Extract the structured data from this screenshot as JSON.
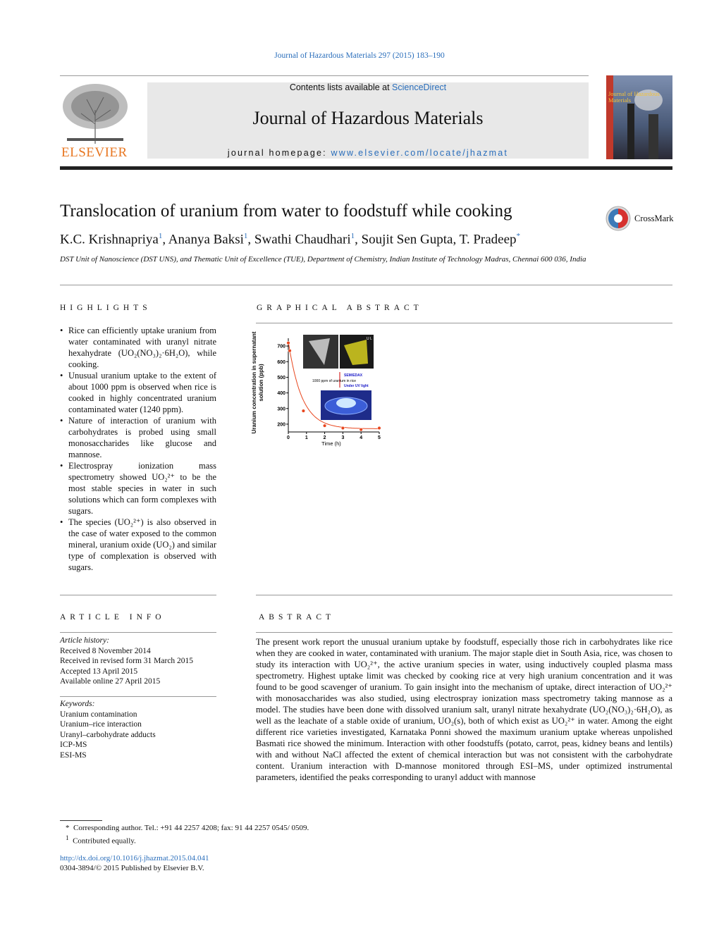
{
  "journal_ref": "Journal of Hazardous Materials 297 (2015) 183–190",
  "header": {
    "contents_prefix": "Contents lists available at ",
    "contents_link": "ScienceDirect",
    "journal_title": "Journal of Hazardous Materials",
    "homepage_prefix": "journal homepage: ",
    "homepage_link": "www.elsevier.com/locate/jhazmat",
    "publisher": "ELSEVIER",
    "cover_text": "Journal of Hazardous Materials"
  },
  "article": {
    "title": "Translocation of uranium from water to foodstuff while cooking",
    "crossmark": "CrossMark",
    "authors": [
      {
        "name": "K.C. Krishnapriya",
        "mark": "1"
      },
      {
        "name": "Ananya Baksi",
        "mark": "1"
      },
      {
        "name": "Swathi Chaudhari",
        "mark": "1"
      },
      {
        "name": "Soujit Sen Gupta",
        "mark": ""
      },
      {
        "name": "T. Pradeep",
        "mark": "*"
      }
    ],
    "affiliation": "DST Unit of Nanoscience (DST UNS), and Thematic Unit of Excellence (TUE), Department of Chemistry, Indian Institute of Technology Madras, Chennai 600 036, India"
  },
  "highlights": {
    "heading": "HIGHLIGHTS",
    "items": [
      "Rice can efficiently uptake uranium from water contaminated with uranyl nitrate hexahydrate (UO₂(NO₃)₂·6H₂O), while cooking.",
      "Unusual uranium uptake to the extent of about 1000 ppm is observed when rice is cooked in highly concentrated uranium contaminated water (1240 ppm).",
      "Nature of interaction of uranium with carbohydrates is probed using small monosaccharides like glucose and mannose.",
      "Electrospray ionization mass spectrometry showed UO₂²⁺ to be the most stable species in water in such solutions which can form complexes with sugars.",
      "The species (UO₂²⁺) is also observed in the case of water exposed to the common mineral, uranium oxide (UO₂) and similar type of complexation is observed with sugars."
    ]
  },
  "graphical_abstract": {
    "heading": "GRAPHICAL ABSTRACT",
    "ylabel": "Uranium concentration in supernatant solution (ppb)",
    "xlabel": "Time (h)",
    "label_sem": "SEM/EDAX",
    "label_ppm": "1000 ppm of uranium in rice",
    "label_uv": "Under UV light",
    "label_u": "U L",
    "chart_data": {
      "type": "scatter",
      "xlabel": "Time (h)",
      "ylabel": "Uranium concentration in supernatant solution (ppb)",
      "xlim": [
        0,
        5
      ],
      "ylim": [
        150,
        750
      ],
      "xticks": [
        "0",
        "1",
        "2",
        "3",
        "4",
        "5"
      ],
      "yticks": [
        "200",
        "300",
        "400",
        "500",
        "600",
        "700"
      ],
      "x": [
        0,
        0.08,
        0.83,
        2,
        3,
        4,
        5
      ],
      "y": [
        720,
        670,
        285,
        190,
        175,
        165,
        175
      ],
      "color": "#e8461e"
    }
  },
  "article_info": {
    "heading": "ARTICLE INFO",
    "history_label": "Article history:",
    "history": [
      "Received 8 November 2014",
      "Received in revised form 31 March 2015",
      "Accepted 13 April 2015",
      "Available online 27 April 2015"
    ],
    "keywords_label": "Keywords:",
    "keywords": [
      "Uranium contamination",
      "Uranium–rice interaction",
      "Uranyl–carbohydrate adducts",
      "ICP-MS",
      "ESI-MS"
    ]
  },
  "abstract": {
    "heading": "ABSTRACT",
    "text": "The present work report the unusual uranium uptake by foodstuff, especially those rich in carbohydrates like rice when they are cooked in water, contaminated with uranium. The major staple diet in South Asia, rice, was chosen to study its interaction with UO₂²⁺, the active uranium species in water, using inductively coupled plasma mass spectrometry. Highest uptake limit was checked by cooking rice at very high uranium concentration and it was found to be good scavenger of uranium. To gain insight into the mechanism of uptake, direct interaction of UO₂²⁺ with monosaccharides was also studied, using electrospray ionization mass spectrometry taking mannose as a model. The studies have been done with dissolved uranium salt, uranyl nitrate hexahydrate (UO₂(NO₃)₂·6H₂O), as well as the leachate of a stable oxide of uranium, UO₂(s), both of which exist as UO₂²⁺ in water. Among the eight different rice varieties investigated, Karnataka Ponni showed the maximum uranium uptake whereas unpolished Basmati rice showed the minimum. Interaction with other foodstuffs (potato, carrot, peas, kidney beans and lentils) with and without NaCl affected the extent of chemical interaction but was not consistent with the carbohydrate content. Uranium interaction with D-mannose monitored through ESI–MS, under optimized instrumental parameters, identified the peaks corresponding to uranyl adduct with mannose"
  },
  "footnotes": {
    "corresponding": "Corresponding author. Tel.: +91 44 2257 4208; fax: 91 44 2257 0545/ 0509.",
    "corresponding_mark": "*",
    "equal": "Contributed equally.",
    "equal_mark": "1",
    "doi": "http://dx.doi.org/10.1016/j.jhazmat.2015.04.041",
    "copyright": "0304-3894/© 2015 Published by Elsevier B.V."
  }
}
